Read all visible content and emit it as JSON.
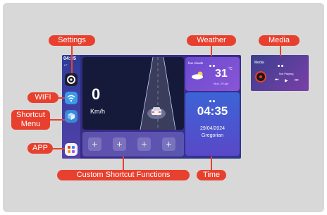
{
  "callouts": {
    "settings": "Settings",
    "weather": "Weather",
    "media": "Media",
    "wifi": "WIFI",
    "shortcut_menu_line1": "Shortcut",
    "shortcut_menu_line2": "Menu",
    "app": "APP",
    "custom_shortcut_functions": "Custom Shortcut Functions",
    "time": "Time"
  },
  "sidebar": {
    "time": "04:35",
    "icons": [
      "settings-gear-icon",
      "wifi-icon",
      "shortcut-menu-icon",
      "app-grid-icon"
    ]
  },
  "speed": {
    "value": "0",
    "unit": "Km/h"
  },
  "shortcuts": {
    "slots": [
      "+",
      "+",
      "+",
      "+"
    ]
  },
  "weather": {
    "description": "few clouds",
    "temperature": "31",
    "degree_symbol": "°C",
    "date": "Mon, 29 Apr"
  },
  "clock": {
    "time": "04:35",
    "date": "29/04/2024",
    "calendar": "Gregorian"
  },
  "media": {
    "title": "Media",
    "status": "Not Playing",
    "controls": [
      "previous-icon",
      "play-icon",
      "next-icon"
    ]
  },
  "colors": {
    "callout": "#e8402e",
    "background": "#d8d8d8"
  }
}
